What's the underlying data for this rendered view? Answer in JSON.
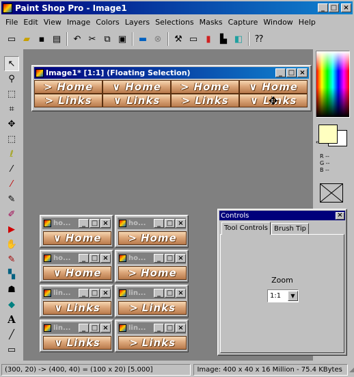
{
  "app": {
    "title": "Paint Shop Pro - Image1"
  },
  "menu": [
    "File",
    "Edit",
    "View",
    "Image",
    "Colors",
    "Layers",
    "Selections",
    "Masks",
    "Capture",
    "Window",
    "Help"
  ],
  "image_window": {
    "title": "Image1* [1:1] (Floating Selection)"
  },
  "graphic_labels": {
    "home": "Home",
    "links": "Links"
  },
  "graphic_markers": {
    "right": ">",
    "down": "∨"
  },
  "mini_windows": [
    {
      "title": "ho...",
      "marker": "∨",
      "label": "Home"
    },
    {
      "title": "ho...",
      "marker": ">",
      "label": "Home"
    },
    {
      "title": "ho...",
      "marker": "∨",
      "label": "Home"
    },
    {
      "title": "ho...",
      "marker": ">",
      "label": "Home"
    },
    {
      "title": "lin...",
      "marker": "∨",
      "label": "Links"
    },
    {
      "title": "lin...",
      "marker": ">",
      "label": "Links"
    },
    {
      "title": "lin...",
      "marker": "∨",
      "label": "Links"
    },
    {
      "title": "lin...",
      "marker": ">",
      "label": "Links"
    }
  ],
  "controls": {
    "title": "Controls",
    "tabs": [
      "Tool Controls",
      "Brush Tip"
    ],
    "zoom_label": "Zoom",
    "zoom_value": "1:1"
  },
  "rgb": {
    "r": "R --",
    "g": "G --",
    "b": "B --"
  },
  "status": {
    "left": "(300, 20) -> (400, 40) = (100 x 20) [5.000]",
    "right": "Image:  400 x 40 x 16 Million - 75.4 KBytes"
  },
  "colors": {
    "title_active": "#00007b",
    "workspace": "#808080",
    "foreground": "#ffffc0"
  }
}
